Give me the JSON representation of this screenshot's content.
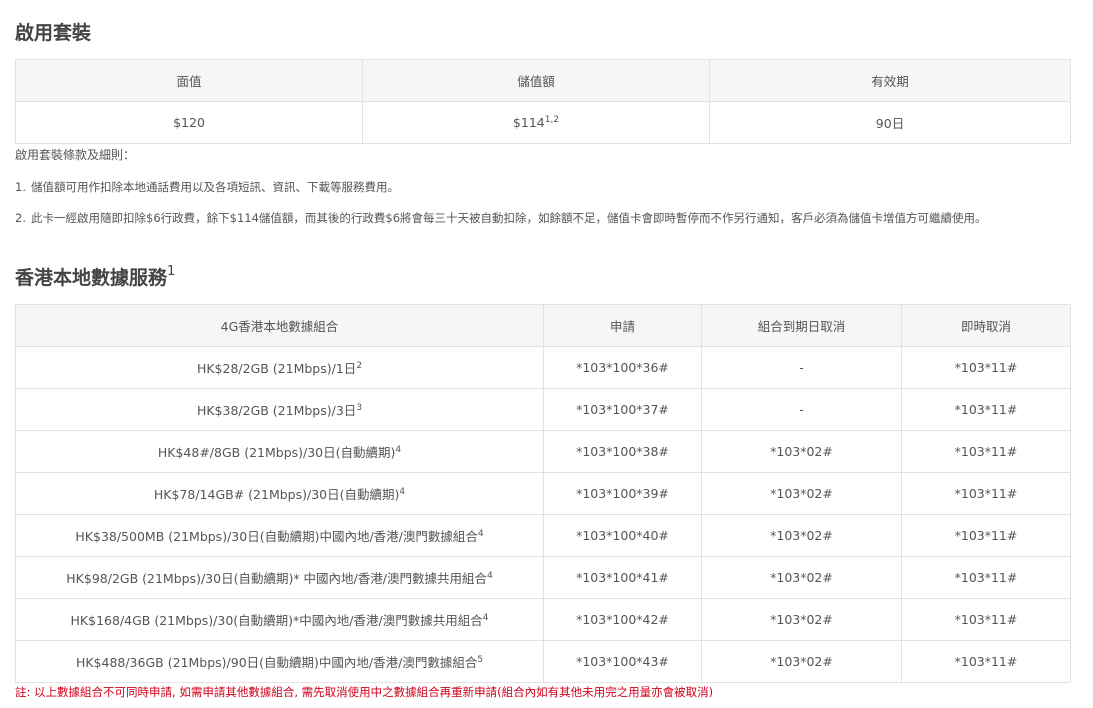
{
  "section1": {
    "title": "啟用套裝",
    "table": {
      "headers": [
        "面值",
        "儲值額",
        "有效期"
      ],
      "row": {
        "face_value": "$120",
        "stored_value": "$114",
        "stored_value_sup": "1,2",
        "validity": "90日"
      }
    },
    "terms_title": "啟用套裝條款及細則：",
    "terms": [
      {
        "num": "1.",
        "text": "儲值額可用作扣除本地通話費用以及各項短訊、資訊、下載等服務費用。"
      },
      {
        "num": "2.",
        "text": "此卡一經啟用隨即扣除$6行政費，餘下$114儲值額，而其後的行政費$6將會每三十天被自動扣除，如餘額不足，儲值卡會即時暫停而不作另行通知，客戶必須為儲值卡增值方可繼續使用。"
      }
    ]
  },
  "section2": {
    "title": "香港本地數據服務",
    "title_sup": "1",
    "table": {
      "headers": [
        "4G香港本地數據組合",
        "申請",
        "組合到期日取消",
        "即時取消"
      ],
      "rows": [
        {
          "plan": "HK$28/2GB (21Mbps)/1日",
          "sup": "2",
          "apply": "*103*100*36#",
          "cancel_expiry": "-",
          "cancel_now": "*103*11#"
        },
        {
          "plan": "HK$38/2GB (21Mbps)/3日",
          "sup": "3",
          "apply": "*103*100*37#",
          "cancel_expiry": "-",
          "cancel_now": "*103*11#"
        },
        {
          "plan": "HK$48#/8GB (21Mbps)/30日(自動續期)",
          "sup": "4",
          "apply": "*103*100*38#",
          "cancel_expiry": "*103*02#",
          "cancel_now": "*103*11#"
        },
        {
          "plan": "HK$78/14GB# (21Mbps)/30日(自動續期)",
          "sup": "4",
          "apply": "*103*100*39#",
          "cancel_expiry": "*103*02#",
          "cancel_now": "*103*11#"
        },
        {
          "plan": "HK$38/500MB (21Mbps)/30日(自動續期)中國內地/香港/澳門數據組合",
          "sup": "4",
          "apply": "*103*100*40#",
          "cancel_expiry": "*103*02#",
          "cancel_now": "*103*11#"
        },
        {
          "plan": "HK$98/2GB (21Mbps)/30日(自動續期)* 中國內地/香港/澳門數據共用組合",
          "sup": "4",
          "apply": "*103*100*41#",
          "cancel_expiry": "*103*02#",
          "cancel_now": "*103*11#"
        },
        {
          "plan": "HK$168/4GB (21Mbps)/30(自動續期)*中國內地/香港/澳門數據共用組合",
          "sup": "4",
          "apply": "*103*100*42#",
          "cancel_expiry": "*103*02#",
          "cancel_now": "*103*11#"
        },
        {
          "plan": "HK$488/36GB (21Mbps)/90日(自動續期)中國內地/香港/澳門數據組合",
          "sup": "5",
          "apply": "*103*100*43#",
          "cancel_expiry": "*103*02#",
          "cancel_now": "*103*11#"
        }
      ]
    },
    "footnote": "註: 以上數據組合不可同時申請, 如需申請其他數據組合, 需先取消使用中之數據組合再重新申請(組合內如有其他未用完之用量亦會被取消)"
  },
  "colors": {
    "border": "#e2e2e2",
    "header_bg": "#f6f6f6",
    "footnote": "#d0021b"
  }
}
